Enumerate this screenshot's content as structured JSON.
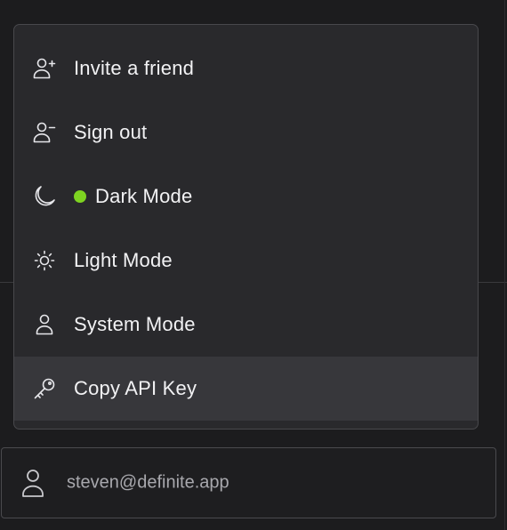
{
  "menu": {
    "items": [
      {
        "label": "Invite a friend",
        "icon": "user-plus-icon"
      },
      {
        "label": "Sign out",
        "icon": "user-minus-icon"
      },
      {
        "label": "Dark Mode",
        "icon": "moon-icon",
        "selected": true
      },
      {
        "label": "Light Mode",
        "icon": "sun-icon"
      },
      {
        "label": "System Mode",
        "icon": "user-icon"
      },
      {
        "label": "Copy API Key",
        "icon": "key-icon",
        "hovered": true
      }
    ]
  },
  "account": {
    "email": "steven@definite.app",
    "icon": "user-icon"
  },
  "colors": {
    "active_dot": "#7ed321",
    "menu_bg": "#29292c",
    "hover_bg": "#37373b",
    "page_bg": "#1c1c1e",
    "text": "#f2f2f4",
    "muted_text": "#a8a8ad"
  }
}
